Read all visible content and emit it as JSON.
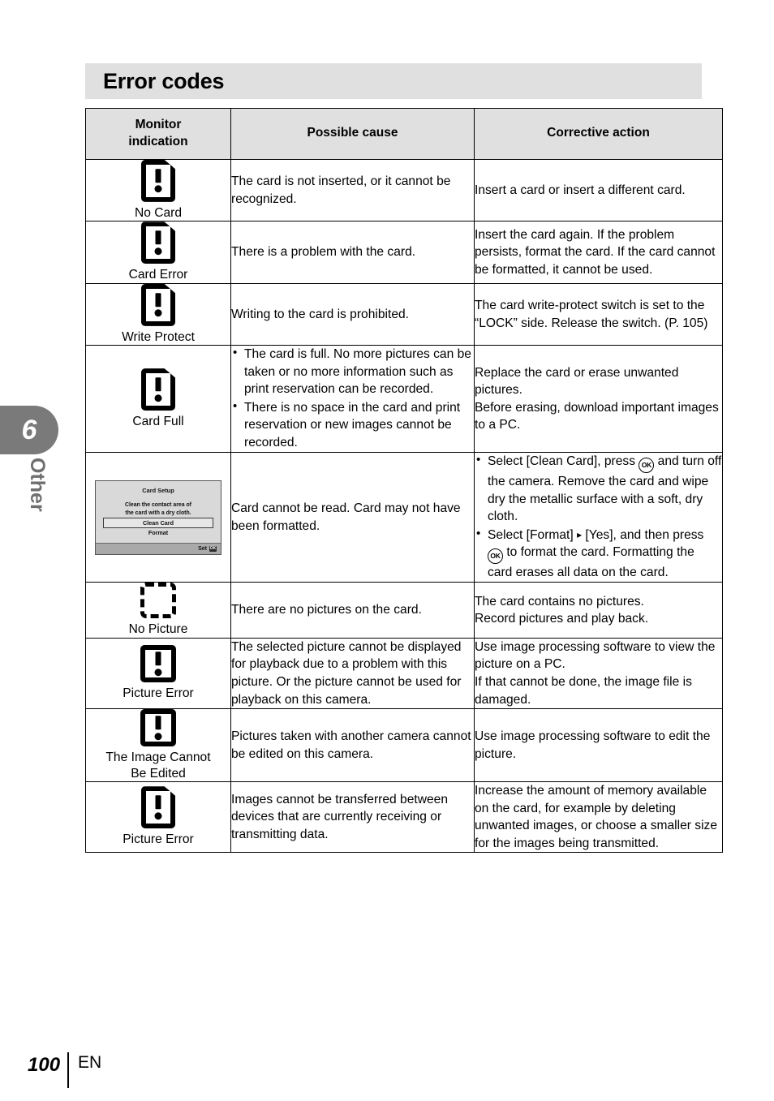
{
  "sidebar": {
    "chapter_number": "6",
    "chapter_label": "Other"
  },
  "heading": {
    "title": "Error codes"
  },
  "table": {
    "headers": {
      "indication": "Monitor\nindication",
      "indication_line1": "Monitor",
      "indication_line2": "indication",
      "cause": "Possible cause",
      "action": "Corrective action"
    },
    "rows": [
      {
        "icon": "card-error-icon",
        "label": "No Card",
        "cause": "The card is not inserted, or it cannot be recognized.",
        "action": "Insert a card or insert a different card."
      },
      {
        "icon": "card-error-icon",
        "label": "Card Error",
        "cause": "There is a problem with the card.",
        "action": "Insert the card again. If the problem persists, format the card. If the card cannot be formatted, it cannot be used."
      },
      {
        "icon": "card-error-icon",
        "label": "Write Protect",
        "cause": "Writing to the card is prohibited.",
        "action": "The card write-protect switch is set to the “LOCK” side. Release the switch. (P. 105)"
      },
      {
        "icon": "card-error-icon",
        "label": "Card Full",
        "cause_bullets": [
          "The card is full. No more pictures can be taken or no more information such as print reservation can be recorded.",
          "There is no space in the card and print reservation or new images cannot be recorded."
        ],
        "action": "Replace the card or erase unwanted pictures.\nBefore erasing, download important images to a PC.",
        "action_line1": "Replace the card or erase unwanted pictures.",
        "action_line2": "Before erasing, download important images to a PC."
      },
      {
        "icon": "card-setup-screen",
        "label": "",
        "cause": "Card cannot be read. Card may not have been formatted.",
        "action_bullets": [
          "Select [Clean Card], press @OK and turn off the camera. Remove the card and wipe dry the metallic surface with a soft, dry cloth.",
          "Select [Format] @TRI [Yes], and then press @OK to format the card. Formatting the card erases all data on the card."
        ]
      },
      {
        "icon": "no-picture-icon",
        "label": "No Picture",
        "cause": "There are no pictures on the card.",
        "action": "The card contains no pictures.\nRecord pictures and play back.",
        "action_line1": "The card contains no pictures.",
        "action_line2": "Record pictures and play back."
      },
      {
        "icon": "picture-error-icon",
        "label": "Picture Error",
        "cause": "The selected picture cannot be displayed for playback due to a problem with this picture. Or the picture cannot be used for playback on this camera.",
        "action": "Use image processing software to view the picture on a PC.\nIf that cannot be done, the image file is damaged.",
        "action_line1": "Use image processing software to view the picture on a PC.",
        "action_line2": "If that cannot be done, the image file is damaged."
      },
      {
        "icon": "picture-error-icon",
        "label": "The Image Cannot Be Edited",
        "label_line1": "The Image Cannot",
        "label_line2": "Be Edited",
        "cause": "Pictures taken with another camera cannot be edited on this camera.",
        "action": "Use image processing software to edit the picture."
      },
      {
        "icon": "card-error-icon",
        "label": "Picture Error",
        "cause": "Images cannot be transferred between devices that are currently receiving or transmitting data.",
        "action": "Increase the amount of memory available on the card, for example by deleting unwanted images, or choose a smaller size for the images being transmitted."
      }
    ]
  },
  "card_setup_screen": {
    "title": "Card Setup",
    "body_line1": "Clean the contact area of",
    "body_line2": "the card with a dry cloth.",
    "option_selected": "Clean Card",
    "option_second": "Format",
    "footer_label": "Set",
    "footer_icon": "ok-button-icon",
    "ok_glyph": "OK"
  },
  "footer": {
    "page_number": "100",
    "language": "EN"
  },
  "colors": {
    "heading_band": "#e0e0e0",
    "table_header": "#e0e0e0",
    "tab": "#7a7a7a",
    "tab_label": "#6f6f6f",
    "border": "#000000"
  }
}
